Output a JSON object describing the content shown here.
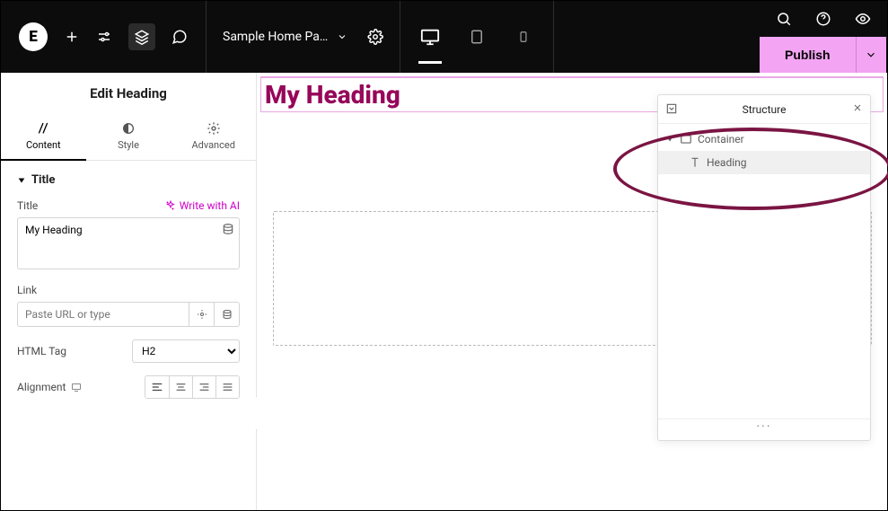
{
  "topbar": {
    "page_title": "Sample Home Pa…",
    "publish_label": "Publish"
  },
  "sidebar": {
    "panel_title": "Edit Heading",
    "tabs": {
      "content": "Content",
      "style": "Style",
      "advanced": "Advanced"
    },
    "section_title": "Title",
    "title_label": "Title",
    "ai_label": "Write with AI",
    "title_value": "My Heading",
    "link_label": "Link",
    "link_placeholder": "Paste URL or type",
    "htmltag_label": "HTML Tag",
    "htmltag_value": "H2",
    "alignment_label": "Alignment"
  },
  "canvas": {
    "heading_text": "My Heading"
  },
  "structure": {
    "title": "Structure",
    "items": [
      {
        "label": "Container"
      },
      {
        "label": "Heading"
      }
    ]
  }
}
